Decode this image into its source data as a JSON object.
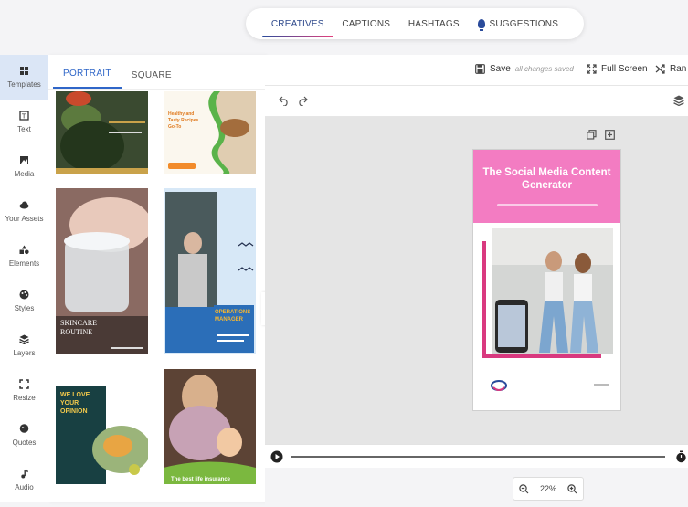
{
  "top_tabs": [
    {
      "label": "CREATIVES",
      "active": true
    },
    {
      "label": "CAPTIONS",
      "active": false
    },
    {
      "label": "HASHTAGS",
      "active": false
    },
    {
      "label": "SUGGESTIONS",
      "active": false,
      "icon": "bulb-icon"
    }
  ],
  "rail": [
    {
      "label": "Templates",
      "icon": "templates-icon",
      "active": true
    },
    {
      "label": "Text",
      "icon": "text-icon"
    },
    {
      "label": "Media",
      "icon": "media-icon"
    },
    {
      "label": "Your Assets",
      "icon": "cloud-icon"
    },
    {
      "label": "Elements",
      "icon": "shapes-icon"
    },
    {
      "label": "Styles",
      "icon": "palette-icon"
    },
    {
      "label": "Layers",
      "icon": "layers-icon"
    },
    {
      "label": "Resize",
      "icon": "resize-icon"
    },
    {
      "label": "Quotes",
      "icon": "quote-icon"
    },
    {
      "label": "Audio",
      "icon": "music-icon"
    }
  ],
  "panel": {
    "tabs": [
      {
        "label": "PORTRAIT",
        "active": true
      },
      {
        "label": "SQUARE",
        "active": false
      }
    ],
    "templates": [
      {
        "text": ""
      },
      {
        "text": "Healthy and Tasty Recipes Go-To"
      },
      {
        "text": "SKINCARE ROUTINE"
      },
      {
        "text": "OPERATIONS MANAGER"
      },
      {
        "text": "WE LOVE YOUR OPINION"
      },
      {
        "text": "The best life insurance"
      }
    ]
  },
  "toolbar": {
    "save_label": "Save",
    "save_status": "all changes saved",
    "fullscreen_label": "Full Screen",
    "random_label": "Ran"
  },
  "design": {
    "title": "The Social Media Content Generator",
    "header_color": "#f37cc2",
    "accent_color": "#d9397f"
  },
  "zoom": {
    "level": "22%"
  },
  "colors": {
    "active_tab": "#2f4a8c",
    "accent_pink": "#e5407d",
    "rail_active_bg": "#dbe6f6"
  }
}
